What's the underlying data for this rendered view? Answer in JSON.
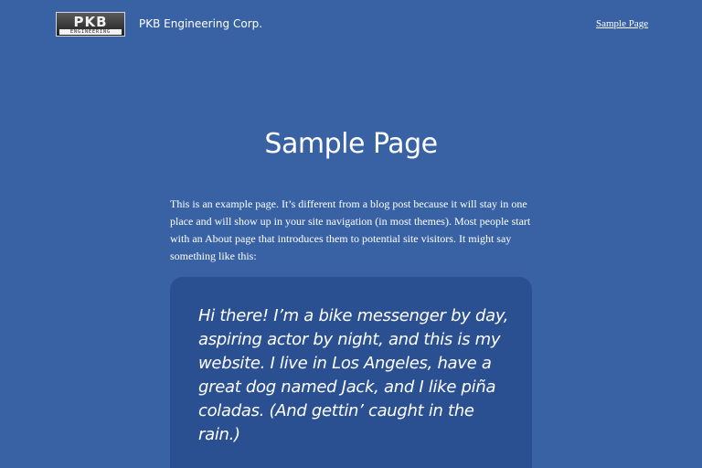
{
  "header": {
    "logo_text": "PKB",
    "logo_subtext": "ENGINEERING",
    "site_title": "PKB Engineering Corp.",
    "nav_link": "Sample Page"
  },
  "main": {
    "title": "Sample Page",
    "intro": "This is an example page. It’s different from a blog post because it will stay in one place and will show up in your site navigation (in most themes). Most people start with an About page that introduces them to potential site visitors. It might say something like this:",
    "quote": "Hi there! I’m a bike messenger by day, aspiring actor by night, and this is my website. I live in Los Angeles, have a great dog named Jack, and I like piña coladas. (And gettin’ caught in the rain.)"
  },
  "colors": {
    "background": "#3862a4",
    "quote_background": "#2b5091",
    "text": "#ffffff"
  }
}
